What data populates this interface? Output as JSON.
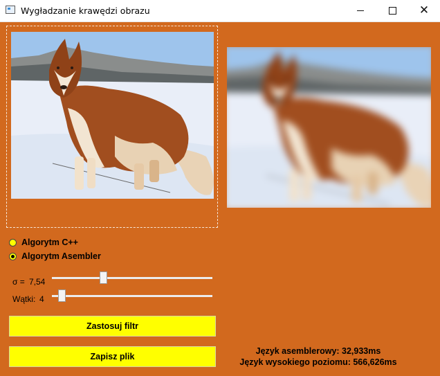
{
  "window": {
    "title": "Wygładzanie krawędzi obrazu",
    "minimize_icon": "minimize-icon",
    "maximize_icon": "maximize-icon",
    "close_icon": "close-icon",
    "close_glyph": "✕"
  },
  "algorithms": [
    {
      "label": "Algorytm C++",
      "selected": false
    },
    {
      "label": "Algorytm Asembler",
      "selected": true
    }
  ],
  "sigma": {
    "label": "σ =",
    "value": "7,54",
    "slider_fraction": 0.31
  },
  "threads": {
    "label": "Wątki:",
    "value": "4",
    "slider_fraction": 0.04
  },
  "buttons": {
    "apply": "Zastosuj filtr",
    "save": "Zapisz plik"
  },
  "timings": {
    "assembler": "Język asemblerowy: 32,933ms",
    "high_level": "Język wysokiego poziomu: 566,626ms"
  },
  "images": {
    "original": "husky-photo-original",
    "filtered": "husky-photo-blurred"
  },
  "colors": {
    "background": "#d2691e",
    "button": "#ffff00",
    "radio": "#ffff00"
  }
}
